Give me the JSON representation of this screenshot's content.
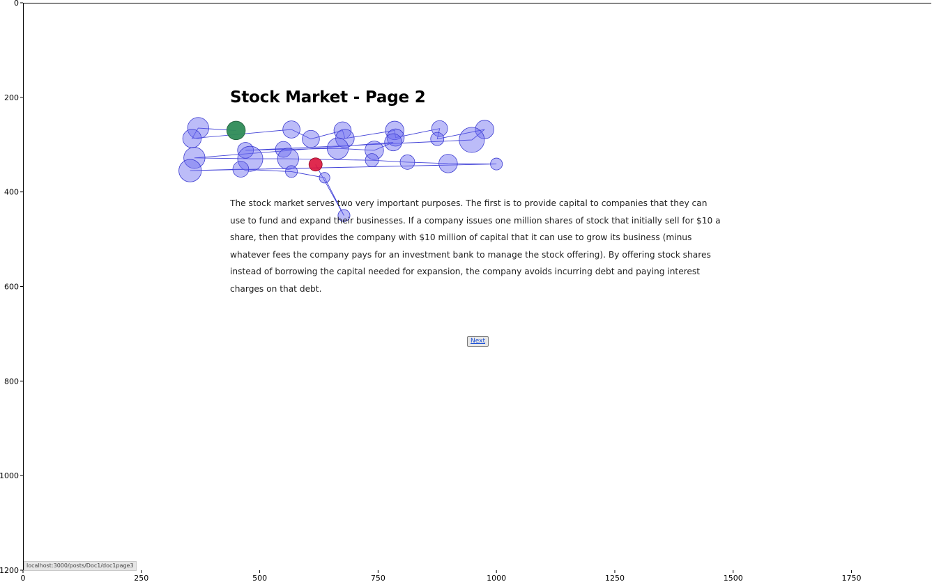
{
  "page": {
    "title": "Stock Market - Page 2",
    "paragraph": "The stock market serves two very important purposes. The first is to provide capital to companies that they can use to fund and expand their businesses. If a company issues one million shares of stock that initially sell for $10 a share, then that provides the company with $10 million of capital that it can use to grow its business (minus whatever fees the company pays for an investment bank to manage the stock offering). By offering stock shares instead of borrowing the capital needed for expansion, the company avoids incurring debt and paying interest charges on that debt.",
    "next_label": "Next"
  },
  "status_bar": {
    "url": "localhost:3000/posts/Doc1/doc1page3"
  },
  "axes": {
    "x_ticks": [
      "0",
      "250",
      "500",
      "750",
      "1000",
      "1250",
      "1500",
      "1750"
    ],
    "y_ticks": [
      "0",
      "200",
      "400",
      "600",
      "800",
      "1000",
      "1200"
    ]
  },
  "chart_data": {
    "type": "scatter",
    "xlim": [
      0,
      1920
    ],
    "ylim": [
      0,
      1200
    ],
    "y_inverted": true,
    "grid": false,
    "colors": {
      "fixation": "#6b6bf0",
      "path": "#2020d0",
      "start": "#2e8b57",
      "end": "#dc143c"
    },
    "points": [
      {
        "x": 450,
        "y": 270,
        "r": 14,
        "kind": "start"
      },
      {
        "x": 370,
        "y": 265,
        "r": 16
      },
      {
        "x": 357,
        "y": 287,
        "r": 14
      },
      {
        "x": 567,
        "y": 268,
        "r": 13
      },
      {
        "x": 608,
        "y": 288,
        "r": 13
      },
      {
        "x": 675,
        "y": 270,
        "r": 13
      },
      {
        "x": 680,
        "y": 287,
        "r": 14
      },
      {
        "x": 785,
        "y": 270,
        "r": 14
      },
      {
        "x": 787,
        "y": 285,
        "r": 13
      },
      {
        "x": 880,
        "y": 266,
        "r": 12
      },
      {
        "x": 875,
        "y": 288,
        "r": 10
      },
      {
        "x": 975,
        "y": 268,
        "r": 14
      },
      {
        "x": 948,
        "y": 290,
        "r": 19
      },
      {
        "x": 470,
        "y": 312,
        "r": 12
      },
      {
        "x": 550,
        "y": 310,
        "r": 12
      },
      {
        "x": 665,
        "y": 308,
        "r": 16
      },
      {
        "x": 742,
        "y": 312,
        "r": 14
      },
      {
        "x": 782,
        "y": 295,
        "r": 13
      },
      {
        "x": 362,
        "y": 328,
        "r": 16
      },
      {
        "x": 480,
        "y": 330,
        "r": 19
      },
      {
        "x": 560,
        "y": 330,
        "r": 16
      },
      {
        "x": 737,
        "y": 333,
        "r": 10
      },
      {
        "x": 812,
        "y": 337,
        "r": 11
      },
      {
        "x": 898,
        "y": 340,
        "r": 14
      },
      {
        "x": 1000,
        "y": 341,
        "r": 9
      },
      {
        "x": 353,
        "y": 355,
        "r": 17
      },
      {
        "x": 460,
        "y": 352,
        "r": 12
      },
      {
        "x": 567,
        "y": 357,
        "r": 9
      },
      {
        "x": 637,
        "y": 370,
        "r": 8
      },
      {
        "x": 678,
        "y": 450,
        "r": 9
      },
      {
        "x": 618,
        "y": 342,
        "r": 10,
        "kind": "end"
      }
    ],
    "path": [
      [
        450,
        270
      ],
      [
        370,
        265
      ],
      [
        357,
        287
      ],
      [
        567,
        268
      ],
      [
        608,
        288
      ],
      [
        675,
        270
      ],
      [
        680,
        287
      ],
      [
        785,
        270
      ],
      [
        787,
        285
      ],
      [
        880,
        266
      ],
      [
        875,
        288
      ],
      [
        975,
        268
      ],
      [
        948,
        290
      ],
      [
        470,
        312
      ],
      [
        550,
        310
      ],
      [
        665,
        308
      ],
      [
        742,
        312
      ],
      [
        782,
        295
      ],
      [
        362,
        328
      ],
      [
        480,
        330
      ],
      [
        560,
        330
      ],
      [
        737,
        333
      ],
      [
        812,
        337
      ],
      [
        898,
        340
      ],
      [
        1000,
        341
      ],
      [
        353,
        355
      ],
      [
        460,
        352
      ],
      [
        567,
        357
      ],
      [
        637,
        370
      ],
      [
        678,
        450
      ],
      [
        618,
        342
      ]
    ]
  }
}
